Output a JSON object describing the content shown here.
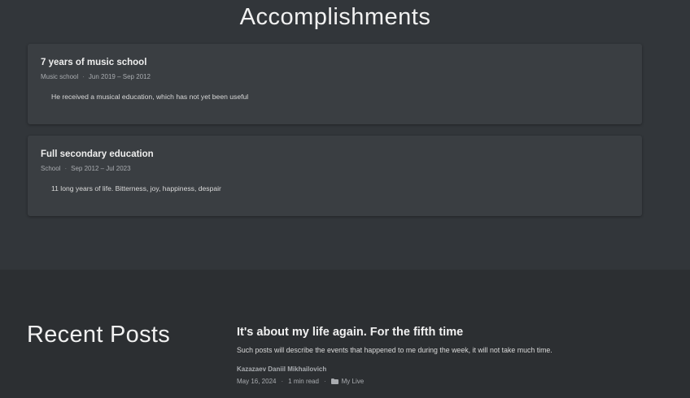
{
  "accomplishments": {
    "title": "Accomplishments",
    "items": [
      {
        "title": "7 years of music school",
        "organization": "Music school",
        "separator": "·",
        "period": "Jun 2019 – Sep 2012",
        "description": "He received a musical education, which has not yet been useful"
      },
      {
        "title": "Full secondary education",
        "organization": "School",
        "separator": "·",
        "period": "Sep 2012 – Jul 2023",
        "description": "11 long years of life. Bitterness, joy, happiness, despair"
      }
    ]
  },
  "recent_posts": {
    "title": "Recent Posts",
    "posts": [
      {
        "title": "It's about my life again. For the fifth time",
        "summary": "Such posts will describe the events that happened to me during the week, it will not take much time.",
        "author": "Kazazaev Daniil Mikhailovich",
        "date": "May 16, 2024",
        "separator": "·",
        "reading_time": "1 min read",
        "category": "My Live",
        "category_icon": "folder-icon"
      }
    ]
  },
  "colors": {
    "background_top": "#32363a",
    "background_bottom": "#2c2f32",
    "card": "#3a3e42",
    "text": "#f1f1f1",
    "muted": "#a9acb0"
  }
}
